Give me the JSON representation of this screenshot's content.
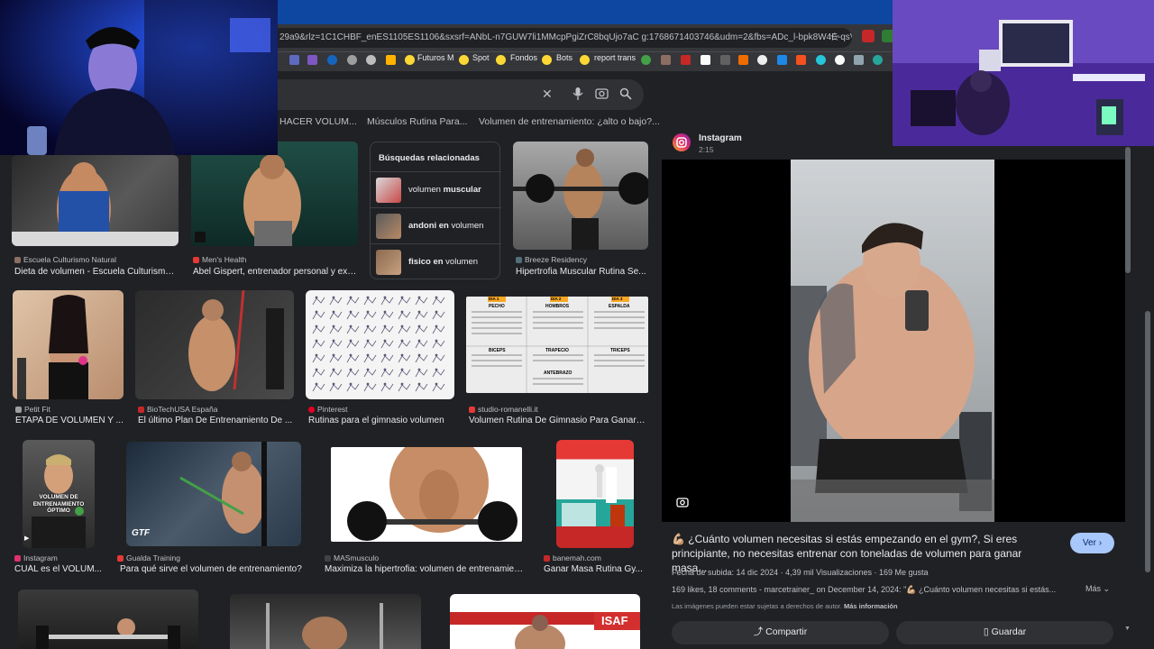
{
  "browser": {
    "url": "29a9&rlz=1C1CHBF_enES1105ES1106&sxsrf=ANbL-n7GUW7li1MMcpPgiZrC8bqUjo7aC g:1768671403746&udm=2&fbs=ADc_l-bpk8W4E-qsVlOv...",
    "bookmarks": [
      "Futuros M",
      "Spot",
      "Fondos",
      "Bots",
      "report trans"
    ]
  },
  "search": {
    "chips": [
      "HACER VOLUM...",
      "Músculos Rutina Para...",
      "Volumen de entrenamiento: ¿alto o bajo?..."
    ]
  },
  "related": {
    "title": "Búsquedas relacionadas",
    "items": [
      {
        "pre": "volumen ",
        "bold": "muscular",
        "post": ""
      },
      {
        "pre": "",
        "bold": "andoni en",
        "post": " volumen"
      },
      {
        "pre": "",
        "bold": "fisico en",
        "post": " volumen"
      }
    ]
  },
  "results": [
    {
      "source": "Escuela Culturismo Natural",
      "title": "Dieta de volumen - Escuela Culturismo ..."
    },
    {
      "source": "Men's Health",
      "title": "Abel Gispert, entrenador personal y exp..."
    },
    {
      "source": "Breeze Residency",
      "title": "Hipertrofia Muscular Rutina Se..."
    },
    {
      "source": "Petit Fit",
      "title": "ETAPA DE VOLUMEN Y ..."
    },
    {
      "source": "BioTechUSA España",
      "title": "El último Plan De Entrenamiento De ..."
    },
    {
      "source": "Pinterest",
      "title": "Rutinas para el gimnasio volumen"
    },
    {
      "source": "studio-romanelli.it",
      "title": "Volumen Rutina De Gimnasio Para Ganar ..."
    },
    {
      "source": "Instagram",
      "title": "CUÁL es el VOLUM..."
    },
    {
      "source": "Gualda Training",
      "title": "Para qué sirve el volumen de entrenamiento?"
    },
    {
      "source": "MASmusculo",
      "title": "Maximiza la hipertrofia: volumen de entrenamiento"
    },
    {
      "source": "banemah.com",
      "title": "Ganar Masa Rutina Gy..."
    }
  ],
  "thumb_text": {
    "instagram_overlay": "VOLUMEN DE ENTRENAMIENTO ÓPTIMO",
    "gtf": "GTF",
    "isaf": "ISAF",
    "chart_cols_1": [
      "DIA 1",
      "DIA 2",
      "DIA 3"
    ],
    "chart_heads_1": [
      "PECHO",
      "HOMBROS",
      "ESPALDA"
    ],
    "chart_heads_2": [
      "BICEPS",
      "TRAPECIO",
      "TRICEPS"
    ],
    "chart_heads_3": "ANTEBRAZO"
  },
  "panel": {
    "site": "Instagram",
    "duration": "2:15",
    "title": "💪🏼 ¿Cuánto volumen necesitas si estás empezando en el gym?, Si eres principiante, no necesitas entrenar con toneladas de volumen para ganar masa...",
    "visit_label": "Ver",
    "meta": "Fecha de subida: 14 dic 2024 · 4,39 mil Visualizaciones · 169 Me gusta",
    "desc": "169 likes, 18 comments - marcetrainer_ on December 14, 2024: \"💪🏼 ¿Cuánto volumen necesitas si estás...",
    "more_label": "Más",
    "rights": "Las imágenes pueden estar sujetas a derechos de autor.",
    "rights_link": "Más información",
    "share_label": "Compartir",
    "save_label": "Guardar"
  },
  "colors": {
    "accent": "#8ab4f8",
    "visit_bg": "#a8c7fa",
    "instagram": "#e1306c"
  }
}
